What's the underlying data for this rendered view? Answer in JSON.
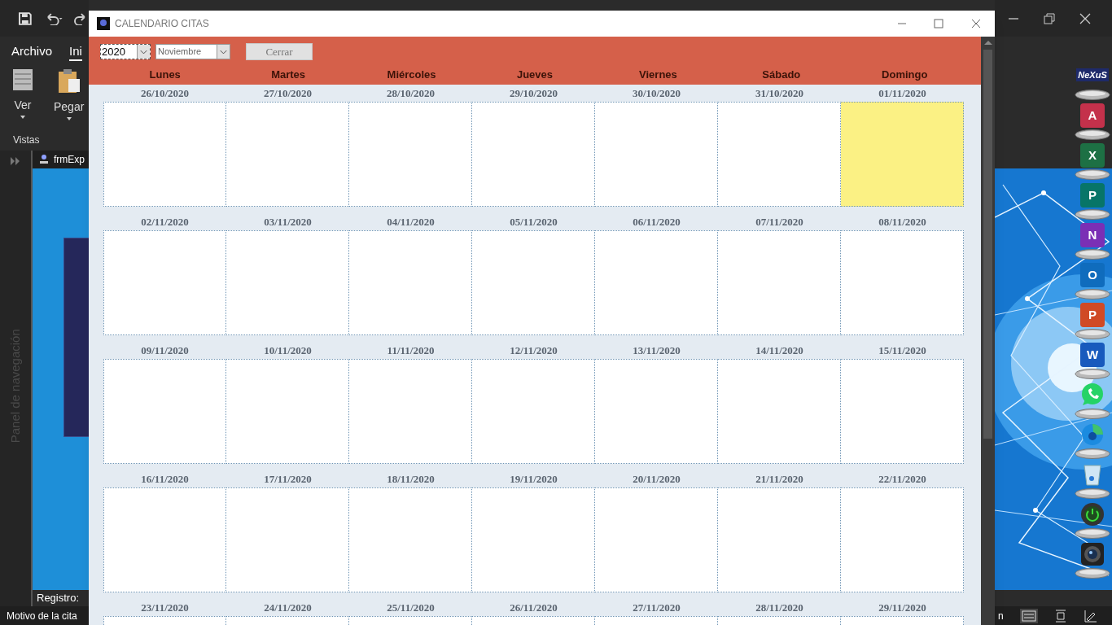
{
  "app": {
    "ribbon_tabs": [
      {
        "label": "Archivo",
        "selected": false
      },
      {
        "label": "Ini",
        "selected": true
      }
    ],
    "ribbon_buttons": [
      {
        "label": "Ver"
      },
      {
        "label": "Pegar"
      }
    ],
    "group_label": "Vistas",
    "nav_pane_title": "Panel de navegación",
    "document_tab": "frmExp",
    "record_nav_label": "Registro:",
    "status_text": "Motivo de la cita",
    "status_text_right": "n"
  },
  "dock": [
    {
      "kind": "logo",
      "text": "NeXuS"
    },
    {
      "kind": "app",
      "letter": "A",
      "color": "#c4314b"
    },
    {
      "kind": "app",
      "letter": "X",
      "color": "#1d7044"
    },
    {
      "kind": "app",
      "letter": "P",
      "color": "#077568"
    },
    {
      "kind": "app",
      "letter": "N",
      "color": "#7b2fb5"
    },
    {
      "kind": "app",
      "letter": "O",
      "color": "#0f6cbd"
    },
    {
      "kind": "app",
      "letter": "P",
      "color": "#d04a25"
    },
    {
      "kind": "app",
      "letter": "W",
      "color": "#185abd"
    },
    {
      "kind": "chat"
    },
    {
      "kind": "browser"
    },
    {
      "kind": "bin"
    },
    {
      "kind": "power"
    },
    {
      "kind": "camera"
    }
  ],
  "window": {
    "title": "CALENDARIO CITAS",
    "year": "2020",
    "month": "Noviembre",
    "close_button": "Cerrar",
    "weekdays": [
      "Lunes",
      "Martes",
      "Miércoles",
      "Jueves",
      "Viernes",
      "Sábado",
      "Domingo"
    ],
    "weeks": [
      [
        {
          "date": "26/10/2020",
          "highlighted": false
        },
        {
          "date": "27/10/2020",
          "highlighted": false
        },
        {
          "date": "28/10/2020",
          "highlighted": false
        },
        {
          "date": "29/10/2020",
          "highlighted": false
        },
        {
          "date": "30/10/2020",
          "highlighted": false
        },
        {
          "date": "31/10/2020",
          "highlighted": false
        },
        {
          "date": "01/11/2020",
          "highlighted": true
        }
      ],
      [
        {
          "date": "02/11/2020",
          "highlighted": false
        },
        {
          "date": "03/11/2020",
          "highlighted": false
        },
        {
          "date": "04/11/2020",
          "highlighted": false
        },
        {
          "date": "05/11/2020",
          "highlighted": false
        },
        {
          "date": "06/11/2020",
          "highlighted": false
        },
        {
          "date": "07/11/2020",
          "highlighted": false
        },
        {
          "date": "08/11/2020",
          "highlighted": false
        }
      ],
      [
        {
          "date": "09/11/2020",
          "highlighted": false
        },
        {
          "date": "10/11/2020",
          "highlighted": false
        },
        {
          "date": "11/11/2020",
          "highlighted": false
        },
        {
          "date": "12/11/2020",
          "highlighted": false
        },
        {
          "date": "13/11/2020",
          "highlighted": false
        },
        {
          "date": "14/11/2020",
          "highlighted": false
        },
        {
          "date": "15/11/2020",
          "highlighted": false
        }
      ],
      [
        {
          "date": "16/11/2020",
          "highlighted": false
        },
        {
          "date": "17/11/2020",
          "highlighted": false
        },
        {
          "date": "18/11/2020",
          "highlighted": false
        },
        {
          "date": "19/11/2020",
          "highlighted": false
        },
        {
          "date": "20/11/2020",
          "highlighted": false
        },
        {
          "date": "21/11/2020",
          "highlighted": false
        },
        {
          "date": "22/11/2020",
          "highlighted": false
        }
      ],
      [
        {
          "date": "23/11/2020",
          "highlighted": false
        },
        {
          "date": "24/11/2020",
          "highlighted": false
        },
        {
          "date": "25/11/2020",
          "highlighted": false
        },
        {
          "date": "26/11/2020",
          "highlighted": false
        },
        {
          "date": "27/11/2020",
          "highlighted": false
        },
        {
          "date": "28/11/2020",
          "highlighted": false
        },
        {
          "date": "29/11/2020",
          "highlighted": false
        }
      ]
    ]
  }
}
